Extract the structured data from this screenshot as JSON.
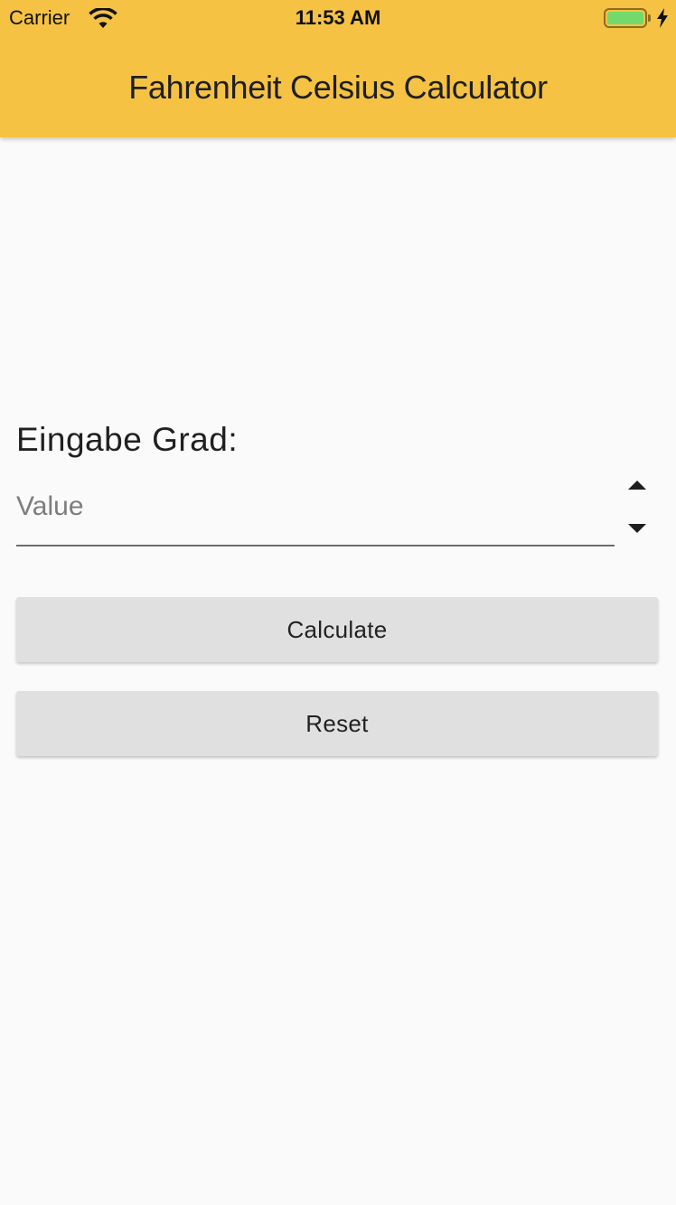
{
  "status_bar": {
    "carrier": "Carrier",
    "time": "11:53 AM",
    "wifi_icon": "wifi-icon",
    "battery_icon": "battery-icon",
    "charging_icon": "bolt-icon",
    "battery_level_percent": 100,
    "battery_color": "#73d96c"
  },
  "app_bar": {
    "title": "Fahrenheit Celsius Calculator",
    "color": "#f5c244"
  },
  "form": {
    "label": "Eingabe Grad:",
    "input_placeholder": "Value",
    "input_value": "",
    "stepper_up_icon": "arrow-up-icon",
    "stepper_down_icon": "arrow-down-icon"
  },
  "buttons": {
    "calculate": "Calculate",
    "reset": "Reset",
    "color": "#e0e0e0"
  }
}
